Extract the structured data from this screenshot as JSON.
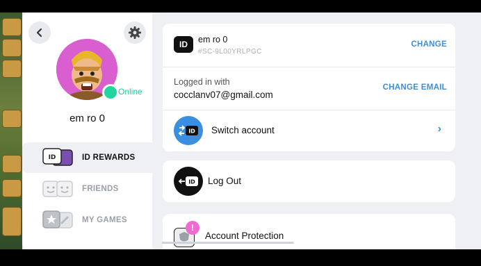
{
  "profile": {
    "name": "em ro 0",
    "status": "Online"
  },
  "nav": [
    {
      "label": "ID REWARDS"
    },
    {
      "label": "FRIENDS"
    },
    {
      "label": "MY GAMES"
    }
  ],
  "account": {
    "name": "em ro 0",
    "tag": "#SC-9L00YRLPGC",
    "change_label": "CHANGE",
    "logged_in_label": "Logged in with",
    "email": "cocclanv07@gmail.com",
    "change_email_label": "CHANGE EMAIL",
    "switch_label": "Switch account",
    "logout_label": "Log Out",
    "protection_label": "Account Protection",
    "id_badge_text": "ID"
  },
  "colors": {
    "accent": "#3a8fe0",
    "online": "#23d3a0",
    "avatar_bg": "#d95fd0",
    "switch_icon_bg": "#3a8fe0",
    "alert_badge": "#f06bd0"
  }
}
